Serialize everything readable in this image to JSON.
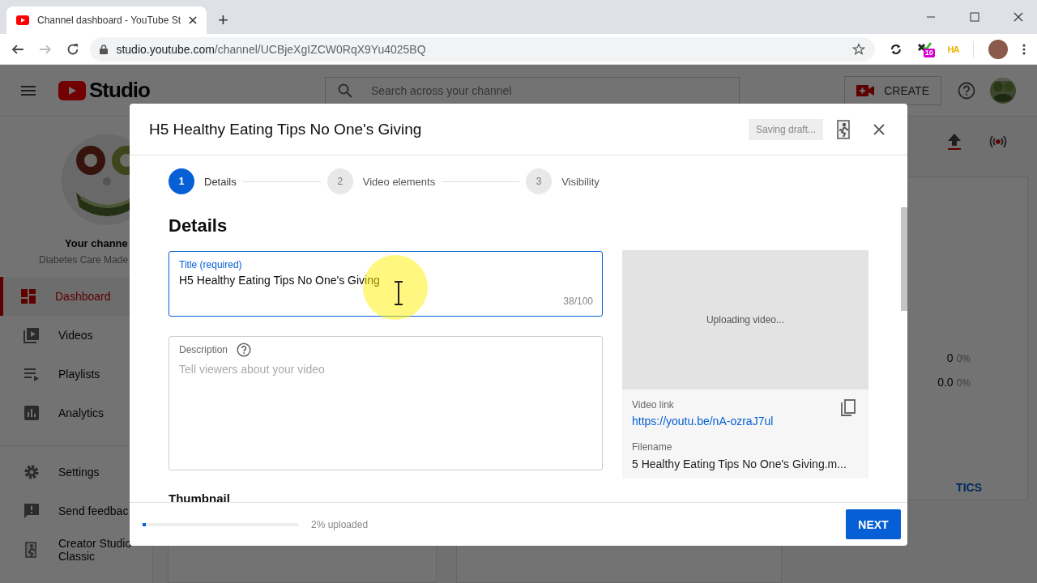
{
  "browser": {
    "tab_title": "Channel dashboard - YouTube St",
    "new_tab": "+",
    "url_host": "studio.youtube.com",
    "url_path": "/channel/UCBjeXgIZCW0RqX9Yu4025BQ",
    "extension_badge": "10",
    "extension_label": "HA"
  },
  "header": {
    "logo_text": "Studio",
    "search_placeholder": "Search across your channel",
    "create_label": "CREATE"
  },
  "sidebar": {
    "channel_name": "Your channe",
    "channel_subtitle": "Diabetes Care Made",
    "items": [
      {
        "label": "Dashboard",
        "selected": true
      },
      {
        "label": "Videos",
        "selected": false
      },
      {
        "label": "Playlists",
        "selected": false
      },
      {
        "label": "Analytics",
        "selected": false
      }
    ],
    "bottom_items": [
      {
        "label": "Settings"
      },
      {
        "label": "Send feedbac"
      },
      {
        "label": "Creator Studio Classic"
      }
    ]
  },
  "dashboard": {
    "stats": [
      {
        "value": "0",
        "change": "0%"
      },
      {
        "value": "0.0",
        "change": "0%"
      }
    ],
    "link": "TICS"
  },
  "modal": {
    "title": "H5 Healthy Eating Tips No One's Giving",
    "status": "Saving draft...",
    "steps": [
      {
        "number": "1",
        "label": "Details",
        "selected": true
      },
      {
        "number": "2",
        "label": "Video elements",
        "selected": false
      },
      {
        "number": "3",
        "label": "Visibility",
        "selected": false
      }
    ],
    "heading": "Details",
    "title_field": {
      "label": "Title (required)",
      "value": "H5 Healthy Eating Tips No One's Giving",
      "counter": "38/100"
    },
    "description_field": {
      "label": "Description",
      "placeholder": "Tell viewers about your video"
    },
    "thumbnail_heading": "Thumbnail",
    "preview": {
      "status": "Uploading video...",
      "link_label": "Video link",
      "link": "https://youtu.be/nA-ozraJ7ul",
      "filename_label": "Filename",
      "filename": "5 Healthy Eating Tips No One's Giving.m..."
    },
    "footer": {
      "progress": {
        "level": 0.02
      },
      "progress_text": "2% uploaded",
      "next_label": "NEXT"
    }
  }
}
